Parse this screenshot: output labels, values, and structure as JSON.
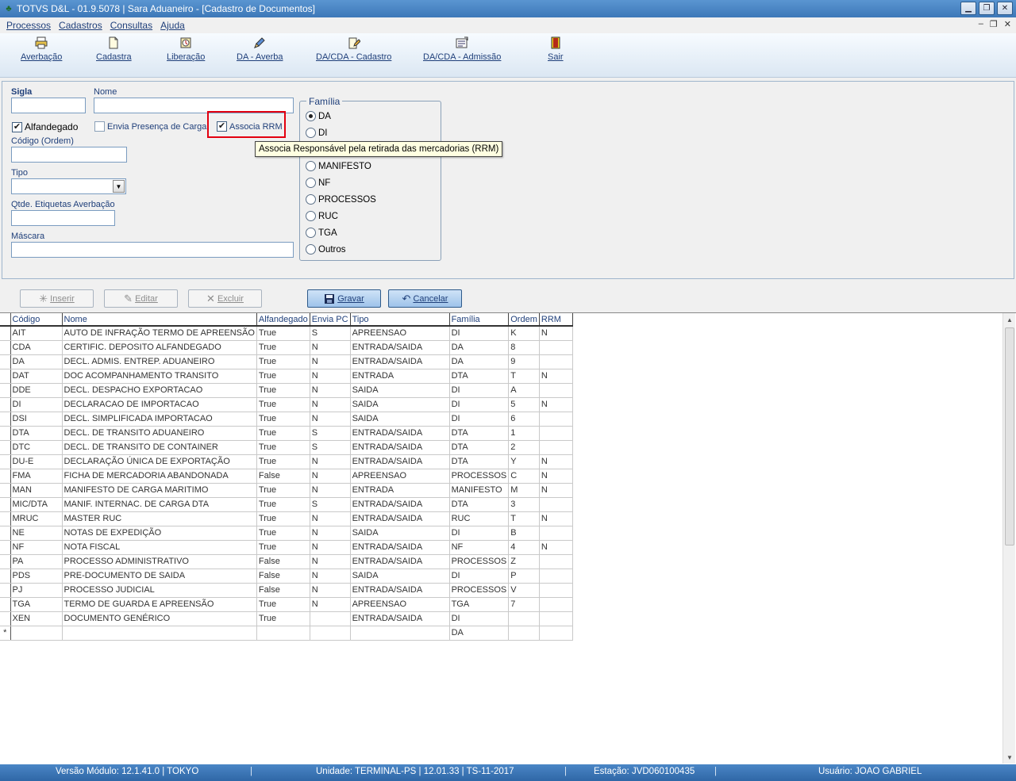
{
  "window": {
    "title": "TOTVS D&L - 01.9.5078 | Sara Aduaneiro - [Cadastro de Documentos]"
  },
  "menu": {
    "items": [
      "Processos",
      "Cadastros",
      "Consultas",
      "Ajuda"
    ]
  },
  "toolbar": {
    "items": [
      {
        "label": "Averbação",
        "icon": "printer-icon"
      },
      {
        "label": "Cadastra",
        "icon": "document-icon"
      },
      {
        "label": "Liberação",
        "icon": "clock-icon"
      },
      {
        "label": "DA - Averba",
        "icon": "pen-icon"
      },
      {
        "label": "DA/CDA - Cadastro",
        "icon": "pen-document-icon"
      },
      {
        "label": "DA/CDA - Admissão",
        "icon": "form-icon"
      },
      {
        "label": "Sair",
        "icon": "exit-door-icon"
      }
    ]
  },
  "form": {
    "sigla_label": "Sigla",
    "nome_label": "Nome",
    "alfandegado_label": "Alfandegado",
    "alfandegado_checked": true,
    "envia_label": "Envia Presença de Carga",
    "envia_checked": false,
    "associa_label": "Associa RRM",
    "associa_checked": true,
    "codigo_label": "Código (Ordem)",
    "tipo_label": "Tipo",
    "qtde_label": "Qtde. Etiquetas Averbação",
    "mascara_label": "Máscara",
    "familia_title": "Família",
    "familia_options": [
      "DA",
      "DI",
      "",
      "MANIFESTO",
      "NF",
      "PROCESSOS",
      "RUC",
      "TGA",
      "Outros"
    ],
    "familia_selected": "DA"
  },
  "tooltip": {
    "text": "Associa Responsável pela retirada das mercadorias (RRM)"
  },
  "actions": {
    "inserir": "Inserir",
    "editar": "Editar",
    "excluir": "Excluir",
    "gravar": "Gravar",
    "cancelar": "Cancelar"
  },
  "grid": {
    "columns": [
      "Código",
      "Nome",
      "Alfandegado",
      "Envia PC",
      "Tipo",
      "Família",
      "Ordem",
      "RRM"
    ],
    "rows": [
      [
        "AIT",
        "AUTO DE INFRAÇÃO TERMO DE APREENSÃO",
        "True",
        "S",
        "APREENSAO",
        "DI",
        "K",
        "N"
      ],
      [
        "CDA",
        "CERTIFIC. DEPOSITO ALFANDEGADO",
        "True",
        "N",
        "ENTRADA/SAIDA",
        "DA",
        "8",
        ""
      ],
      [
        "DA",
        "DECL. ADMIS. ENTREP. ADUANEIRO",
        "True",
        "N",
        "ENTRADA/SAIDA",
        "DA",
        "9",
        ""
      ],
      [
        "DAT",
        "DOC ACOMPANHAMENTO TRANSITO",
        "True",
        "N",
        "ENTRADA",
        "DTA",
        "T",
        "N"
      ],
      [
        "DDE",
        "DECL. DESPACHO EXPORTACAO",
        "True",
        "N",
        "SAIDA",
        "DI",
        "A",
        ""
      ],
      [
        "DI",
        "DECLARACAO DE IMPORTACAO",
        "True",
        "N",
        "SAIDA",
        "DI",
        "5",
        "N"
      ],
      [
        "DSI",
        "DECL. SIMPLIFICADA IMPORTACAO",
        "True",
        "N",
        "SAIDA",
        "DI",
        "6",
        ""
      ],
      [
        "DTA",
        "DECL. DE TRANSITO ADUANEIRO",
        "True",
        "S",
        "ENTRADA/SAIDA",
        "DTA",
        "1",
        ""
      ],
      [
        "DTC",
        "DECL. DE TRANSITO DE CONTAINER",
        "True",
        "S",
        "ENTRADA/SAIDA",
        "DTA",
        "2",
        ""
      ],
      [
        "DU-E",
        "DECLARAÇÃO ÚNICA DE EXPORTAÇÃO",
        "True",
        "N",
        "ENTRADA/SAIDA",
        "DTA",
        "Y",
        "N"
      ],
      [
        "FMA",
        "FICHA DE MERCADORIA ABANDONADA",
        "False",
        "N",
        "APREENSAO",
        "PROCESSOS",
        "C",
        "N"
      ],
      [
        "MAN",
        "MANIFESTO DE CARGA MARITIMO",
        "True",
        "N",
        "ENTRADA",
        "MANIFESTO",
        "M",
        "N"
      ],
      [
        "MIC/DTA",
        "MANIF. INTERNAC. DE CARGA DTA",
        "True",
        "S",
        "ENTRADA/SAIDA",
        "DTA",
        "3",
        ""
      ],
      [
        "MRUC",
        "MASTER RUC",
        "True",
        "N",
        "ENTRADA/SAIDA",
        "RUC",
        "T",
        "N"
      ],
      [
        "NE",
        "NOTAS DE EXPEDIÇÃO",
        "True",
        "N",
        "SAIDA",
        "DI",
        "B",
        ""
      ],
      [
        "NF",
        "NOTA FISCAL",
        "True",
        "N",
        "ENTRADA/SAIDA",
        "NF",
        "4",
        "N"
      ],
      [
        "PA",
        "PROCESSO ADMINISTRATIVO",
        "False",
        "N",
        "ENTRADA/SAIDA",
        "PROCESSOS",
        "Z",
        ""
      ],
      [
        "PDS",
        "PRE-DOCUMENTO DE SAIDA",
        "False",
        "N",
        "SAIDA",
        "DI",
        "P",
        ""
      ],
      [
        "PJ",
        "PROCESSO JUDICIAL",
        "False",
        "N",
        "ENTRADA/SAIDA",
        "PROCESSOS",
        "V",
        ""
      ],
      [
        "TGA",
        "TERMO DE GUARDA E APREENSÃO",
        "True",
        "N",
        "APREENSAO",
        "TGA",
        "7",
        ""
      ],
      [
        "XEN",
        "DOCUMENTO GENÉRICO",
        "True",
        "",
        "ENTRADA/SAIDA",
        "DI",
        "",
        ""
      ],
      [
        "",
        "",
        "",
        "",
        "",
        "DA",
        "",
        ""
      ]
    ],
    "new_row_marker": "*"
  },
  "status": {
    "versao": "Versão Módulo:  12.1.41.0  |  TOKYO",
    "unidade": "Unidade: TERMINAL-PS | 12.01.33 | TS-11-2017",
    "estacao": "Estação: JVD060100435",
    "usuario": "Usuário: JOAO GABRIEL",
    "separator": "|"
  },
  "colors": {
    "title_bar": "#3d78b8",
    "status_bar": "#2f67a6",
    "label_blue": "#1f3f7a",
    "highlight_red": "#e3000f",
    "tooltip_bg": "#ffffe1"
  }
}
